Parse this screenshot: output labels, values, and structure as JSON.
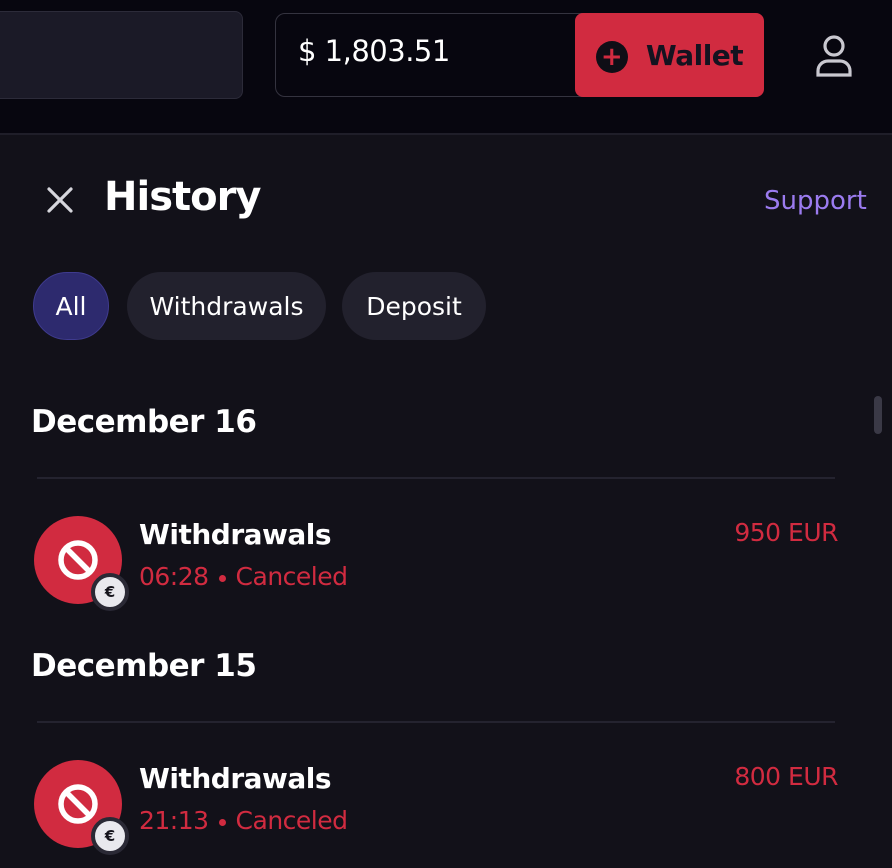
{
  "header": {
    "balance": "$ 1,803.51",
    "wallet_button": {
      "label": "Wallet",
      "icon": "plus-circle-icon"
    },
    "user_icon": "user-icon"
  },
  "panel": {
    "title": "History",
    "support_link": "Support",
    "filters": [
      {
        "label": "All",
        "active": true
      },
      {
        "label": "Withdrawals",
        "active": false
      },
      {
        "label": "Deposit",
        "active": false
      }
    ]
  },
  "groups": [
    {
      "date": "December 16",
      "transactions": [
        {
          "type": "Withdrawals",
          "time": "06:28",
          "status": "Canceled",
          "amount": "950 EUR",
          "currency_badge": "€"
        }
      ]
    },
    {
      "date": "December 15",
      "transactions": [
        {
          "type": "Withdrawals",
          "time": "21:13",
          "status": "Canceled",
          "amount": "800 EUR",
          "currency_badge": "€"
        }
      ]
    }
  ],
  "colors": {
    "accent": "#d12b40",
    "support": "#9b7bef",
    "chip_active": "#2d2a6e",
    "background": "#121119"
  }
}
